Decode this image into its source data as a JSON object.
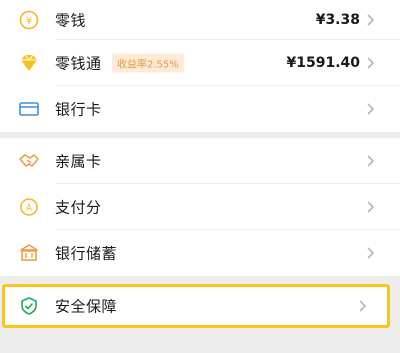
{
  "accent_color": "#f7c720",
  "section1": [
    {
      "name": "change",
      "label": "零钱",
      "value": "¥3.38",
      "icon": "coin-icon"
    },
    {
      "name": "lingqiantong",
      "label": "零钱通",
      "badge": "收益率2.55%",
      "value": "¥1591.40",
      "icon": "diamond-icon"
    },
    {
      "name": "bank-card",
      "label": "银行卡",
      "icon": "card-icon"
    }
  ],
  "section2": [
    {
      "name": "family-card",
      "label": "亲属卡",
      "icon": "handshake-icon"
    },
    {
      "name": "payscore",
      "label": "支付分",
      "icon": "score-icon"
    },
    {
      "name": "bank-savings",
      "label": "银行储蓄",
      "icon": "bank-icon"
    }
  ],
  "section3": [
    {
      "name": "security",
      "label": "安全保障",
      "icon": "shield-icon"
    }
  ]
}
